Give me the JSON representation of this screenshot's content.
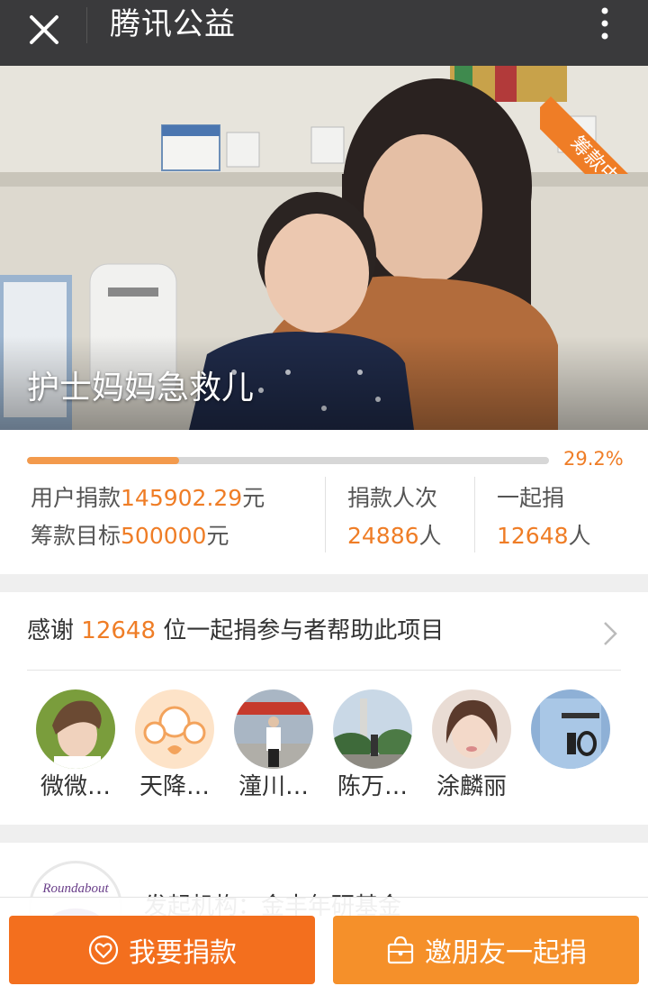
{
  "topbar": {
    "title": "腾讯公益"
  },
  "hero": {
    "title": "护士妈妈急救儿",
    "status_ribbon": "筹款中"
  },
  "stats": {
    "progress": 0.292,
    "percent_text": "29.2%",
    "raised_label": "用户捐款",
    "raised_value": "145902.29",
    "raised_unit": "元",
    "goal_label": "筹款目标",
    "goal_value": "500000",
    "goal_unit": "元",
    "donations_label": "捐款人次",
    "donations_value": "24886",
    "donations_unit": "人",
    "together_label": "一起捐",
    "together_value": "12648",
    "together_unit": "人"
  },
  "thanks": {
    "prefix": "感谢",
    "count": "12648",
    "suffix": "位一起捐参与者帮助此项目"
  },
  "donors": [
    {
      "name": "微微…"
    },
    {
      "name": "天降…"
    },
    {
      "name": "潼川…"
    },
    {
      "name": "陈万…"
    },
    {
      "name": "涂麟丽"
    },
    {
      "name": ""
    }
  ],
  "initiator": {
    "text": "发起机构：金丰年研基金",
    "logo_text": "Roundabout"
  },
  "actions": {
    "donate_label": "我要捐款",
    "invite_label": "邀朋友一起捐"
  },
  "colors": {
    "accent": "#ef7d26",
    "topbar": "#3a3a3c",
    "donate_button": "#f36f1e",
    "invite_button": "#f5902a"
  }
}
